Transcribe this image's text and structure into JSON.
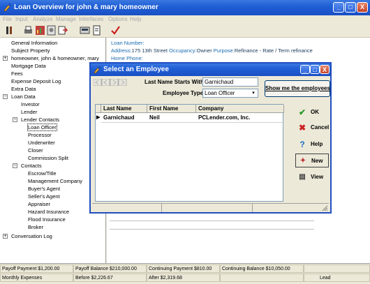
{
  "app": {
    "title": "Loan Overview for john & mary homeowner",
    "window_buttons": [
      "_",
      "□",
      "X"
    ]
  },
  "menu": [
    "File",
    "Input",
    "Analyze",
    "Manage",
    "Interfaces",
    "Options",
    "Help"
  ],
  "tree": [
    {
      "label": "General Information"
    },
    {
      "label": "Subject Property"
    },
    {
      "label": "homeowner, john & homeowner, mary"
    },
    {
      "label": "Mortgage Data"
    },
    {
      "label": "Fees"
    },
    {
      "label": "Expense Deposit Log"
    },
    {
      "label": "Extra Data"
    },
    {
      "label": "Loan Data"
    },
    {
      "label": "Investor"
    },
    {
      "label": "Lender"
    },
    {
      "label": "Lender Contacts"
    },
    {
      "label": "Loan Officer"
    },
    {
      "label": "Processor"
    },
    {
      "label": "Underwriter"
    },
    {
      "label": "Closer"
    },
    {
      "label": "Commission Split"
    },
    {
      "label": "Contacts"
    },
    {
      "label": "Escrow/Title"
    },
    {
      "label": "Management Company"
    },
    {
      "label": "Buyer's Agent"
    },
    {
      "label": "Seller's Agent"
    },
    {
      "label": "Appraiser"
    },
    {
      "label": "Hazard Insurance"
    },
    {
      "label": "Flood Insurance"
    },
    {
      "label": "Broker"
    },
    {
      "label": "Conversation Log"
    }
  ],
  "overview": {
    "loan_number_label": "Loan Number:",
    "address_label": "Address:",
    "address_value": "175 13th Street",
    "occupancy_label": "Occupancy:",
    "occupancy_value": "Owner",
    "purpose_label": "Purpose:",
    "purpose_value": "Refinance - Rate / Term refinance",
    "home_phone_label": "Home Phone:"
  },
  "dialog": {
    "title": "Select an Employee",
    "last_name_label": "Last Name Starts With",
    "last_name_value": "Garnichaud",
    "emp_type_label": "Employee Type",
    "emp_type_value": "Loan Officer",
    "show_button": "Show me the employees",
    "columns": [
      "Last Name",
      "First Name",
      "Company"
    ],
    "rows": [
      {
        "last": "Garnichaud",
        "first": "Neil",
        "company": "PCLender.com, Inc."
      }
    ],
    "buttons": {
      "ok": "OK",
      "cancel": "Cancel",
      "help": "Help",
      "new": "New",
      "view": "View"
    }
  },
  "status": {
    "payoff_payment": "Payoff Payment $1,200.00",
    "payoff_balance": "Payoff Balance $210,000.00",
    "continuing_payment": "Continuing Payment $810.00",
    "continuing_balance": "Continuing Balance $10,050.00",
    "monthly_expenses": "Monthly Expenses",
    "before": "Before $2,226.67",
    "after": "After $2,319.68",
    "lead": "Lead"
  },
  "colors": {
    "titlebar": "#1f5fd6",
    "link_text": "#1a6bb0",
    "ok_check": "#2a9a2a",
    "cancel_x": "#cc2222"
  }
}
